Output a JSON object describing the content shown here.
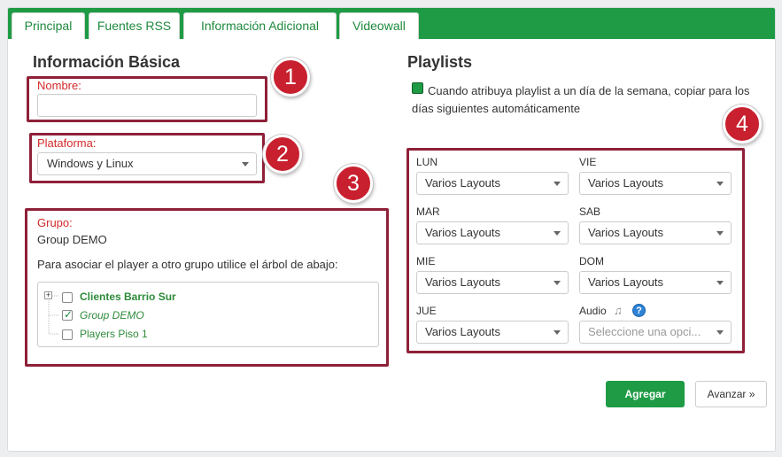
{
  "tabs": [
    {
      "label": "Principal",
      "active": true
    },
    {
      "label": "Fuentes RSS",
      "active": false
    },
    {
      "label": "Información Adicional",
      "active": false
    },
    {
      "label": "Videowall",
      "active": false
    }
  ],
  "basic": {
    "heading": "Información Básica",
    "nombre_label": "Nombre:",
    "nombre_value": "",
    "plataforma_label": "Plataforma:",
    "plataforma_value": "Windows y Linux",
    "grupo_label": "Grupo:",
    "grupo_value": "Group DEMO",
    "tree_hint": "Para asociar el player a otro grupo utilice el árbol de abajo:",
    "tree": [
      {
        "label": "Clientes Barrio Sur",
        "checked": false,
        "expandable": true
      },
      {
        "label": "Group DEMO",
        "checked": true,
        "expandable": false
      },
      {
        "label": "Players Piso 1",
        "checked": false,
        "expandable": false
      }
    ]
  },
  "playlists": {
    "heading": "Playlists",
    "auto_option": "Cuando atribuya playlist a un día de la semana, copiar para los días siguientes automáticamente",
    "auto_option_checked": true,
    "days": [
      {
        "label": "LUN",
        "value": "Varios Layouts"
      },
      {
        "label": "VIE",
        "value": "Varios Layouts"
      },
      {
        "label": "MAR",
        "value": "Varios Layouts"
      },
      {
        "label": "SAB",
        "value": "Varios Layouts"
      },
      {
        "label": "MIE",
        "value": "Varios Layouts"
      },
      {
        "label": "DOM",
        "value": "Varios Layouts"
      },
      {
        "label": "JUE",
        "value": "Varios Layouts"
      }
    ],
    "audio_label": "Audio",
    "audio_placeholder": "Seleccione una opci..."
  },
  "buttons": {
    "add": "Agregar",
    "next": "Avanzar »"
  },
  "annotations": [
    "1",
    "2",
    "3",
    "4"
  ],
  "colors": {
    "brand_green": "#1e9b44",
    "annotation_red": "#c8202f",
    "annotation_border": "#8e2038",
    "label_red": "#d42a2a"
  },
  "icons": [
    "music-note-icon",
    "help-icon",
    "chevron-down-icon",
    "checkbox-check-icon",
    "tree-expand-icon"
  ]
}
